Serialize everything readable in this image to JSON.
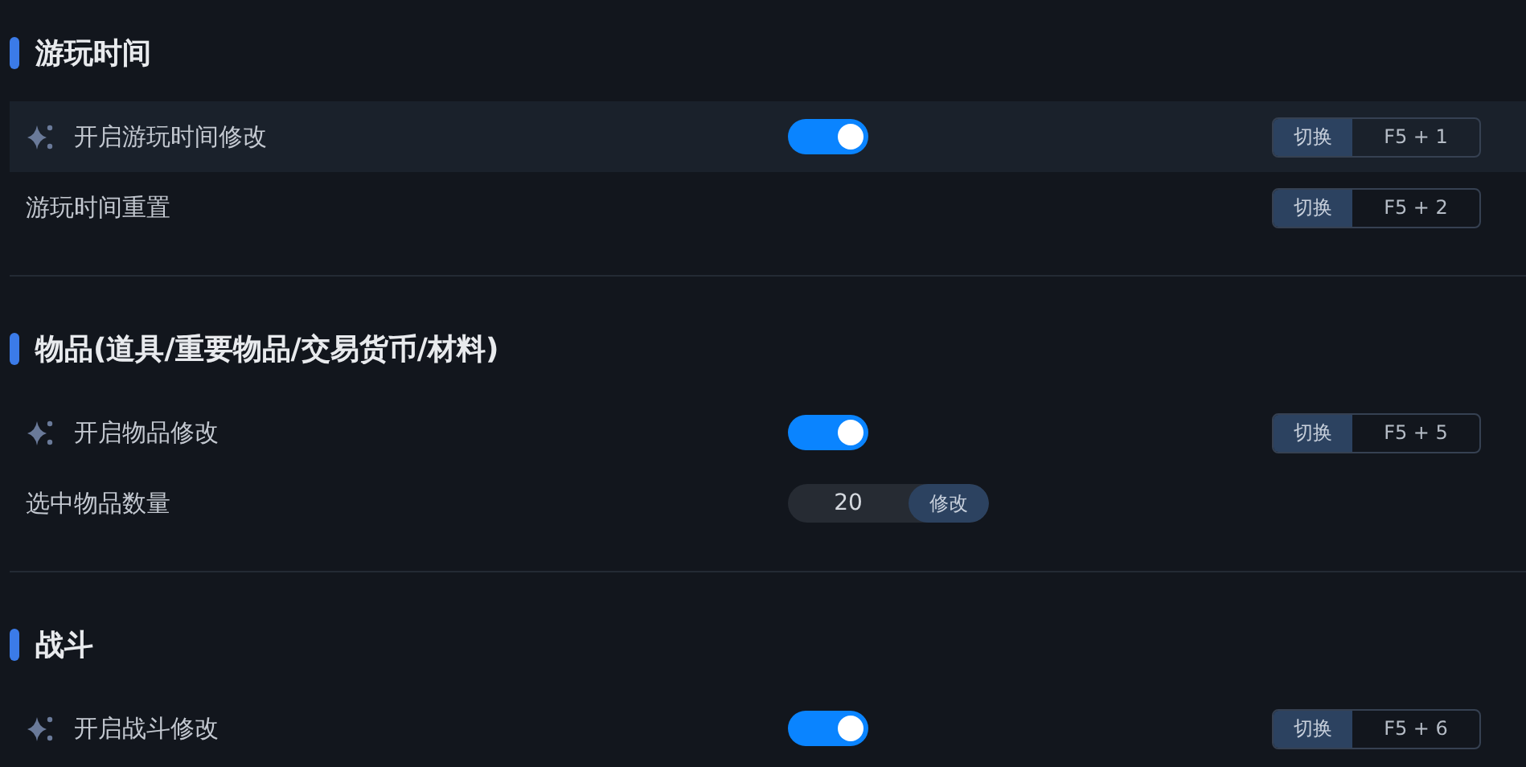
{
  "sections": [
    {
      "title": "游玩时间",
      "rows": [
        {
          "kind": "toggle",
          "label": "开启游玩时间修改",
          "highlighted": true,
          "on": true,
          "hotkey_button": "切换",
          "hotkey": "F5 + 1"
        },
        {
          "kind": "action",
          "label": "游玩时间重置",
          "highlighted": false,
          "hotkey_button": "切换",
          "hotkey": "F5 + 2"
        }
      ]
    },
    {
      "title": "物品(道具/重要物品/交易货币/材料)",
      "rows": [
        {
          "kind": "toggle",
          "label": "开启物品修改",
          "highlighted": false,
          "on": true,
          "hotkey_button": "切换",
          "hotkey": "F5 + 5"
        },
        {
          "kind": "number",
          "label": "选中物品数量",
          "highlighted": false,
          "value": "20",
          "button": "修改"
        }
      ]
    },
    {
      "title": "战斗",
      "rows": [
        {
          "kind": "toggle",
          "label": "开启战斗修改",
          "highlighted": false,
          "on": true,
          "hotkey_button": "切换",
          "hotkey": "F5 + 6"
        }
      ]
    }
  ]
}
